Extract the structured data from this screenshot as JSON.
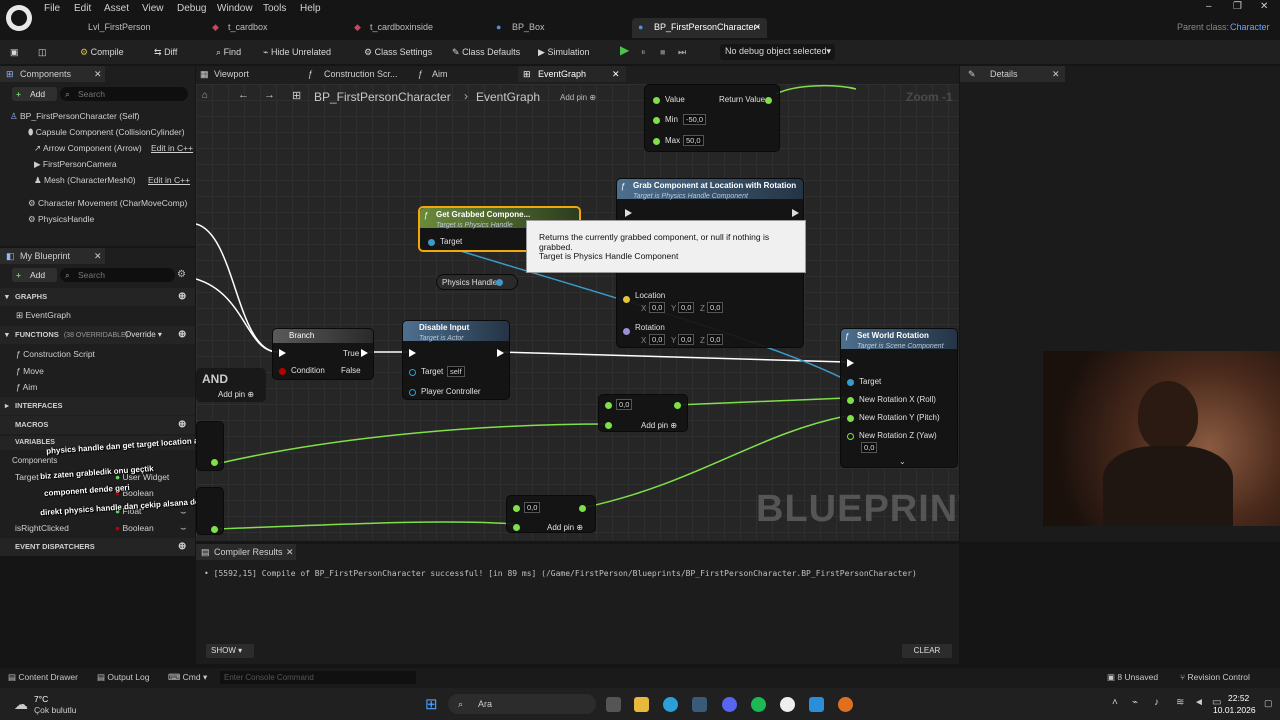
{
  "menu": [
    "File",
    "Edit",
    "Asset",
    "View",
    "Debug",
    "Window",
    "Tools",
    "Help"
  ],
  "tabs": [
    "Lvl_FirstPerson",
    "t_cardbox",
    "t_cardboxinside",
    "BP_Box",
    "BP_FirstPersonCharacter•"
  ],
  "parent_class_label": "Parent class:",
  "parent_class_value": "Character",
  "toolbar": {
    "compile": "Compile",
    "diff": "Diff",
    "find": "Find",
    "hide_unrelated": "Hide Unrelated",
    "class_settings": "Class Settings",
    "class_defaults": "Class Defaults",
    "simulation": "Simulation",
    "debug_select": "No debug object selected"
  },
  "components_panel": {
    "tab": "Components",
    "add": "Add",
    "search_placeholder": "Search",
    "items": [
      "BP_FirstPersonCharacter (Self)",
      "Capsule Component (CollisionCylinder)",
      "Arrow Component (Arrow)",
      "FirstPersonCamera",
      "Mesh (CharacterMesh0)",
      "Character Movement (CharMoveComp)",
      "PhysicsHandle"
    ],
    "edit_cpp": "Edit in C++"
  },
  "my_blueprint": {
    "tab": "My Blueprint",
    "add": "Add",
    "search_placeholder": "Search",
    "graphs": "GRAPHS",
    "event_graph": "EventGraph",
    "functions": "FUNCTIONS",
    "functions_count": "(38 OVERRIDABLE)",
    "override": "Override",
    "function_items": [
      "Construction Script",
      "Move",
      "Aim"
    ],
    "interfaces": "INTERFACES",
    "macros": "MACROS",
    "variables": "VARIABLES",
    "var_components": "Components",
    "var_rows": [
      {
        "name": "Target",
        "type": "User Widget"
      },
      {
        "name": "",
        "type": "Boolean"
      },
      {
        "name": "",
        "type": "Float"
      },
      {
        "name": "isRightClicked",
        "type": "Boolean"
      }
    ],
    "event_dispatchers": "EVENT DISPATCHERS"
  },
  "graph_tabs": [
    "Viewport",
    "Construction Scr...",
    "Aim",
    "EventGraph"
  ],
  "breadcrumb": {
    "root": "BP_FirstPersonCharacter",
    "leaf": "EventGraph"
  },
  "zoom": "Zoom -1",
  "watermark": "BLUEPRINT",
  "nodes": {
    "clamp": {
      "value": "Value",
      "return": "Return Value",
      "min_label": "Min",
      "min": "-50,0",
      "max_label": "Max",
      "max": "50,0"
    },
    "get_grabbed": {
      "title": "Get Grabbed Compone...",
      "sub": "Target is Physics Handle",
      "target": "Target"
    },
    "physics_handle": "Physics Handle",
    "grab": {
      "title": "Grab Component at Location with Rotation",
      "sub": "Target is Physics Handle Component",
      "location": "Location",
      "rotation": "Rotation",
      "zero": "0,0",
      "x": "X",
      "y": "Y",
      "z": "Z"
    },
    "branch": {
      "title": "Branch",
      "condition": "Condition",
      "true": "True",
      "false": "False"
    },
    "disable_input": {
      "title": "Disable Input",
      "sub": "Target is Actor",
      "target": "Target",
      "self": "self",
      "controller": "Player Controller"
    },
    "set_world_rotation": {
      "title": "Set World Rotation",
      "sub": "Target is Scene Component",
      "target": "Target",
      "roll": "New Rotation X (Roll)",
      "pitch": "New Rotation Y (Pitch)",
      "yaw": "New Rotation Z (Yaw)",
      "yaw_val": "0,0"
    },
    "and": {
      "title": "AND",
      "add_pin": "Add pin"
    },
    "add1": {
      "val": "0,0",
      "add_pin": "Add pin"
    },
    "add2": {
      "val": "0,0",
      "add_pin": "Add pin"
    },
    "top_add_pin": "Add pin"
  },
  "tooltip": {
    "line1": "Returns the currently grabbed component, or null if nothing is grabbed.",
    "line2": "Target is Physics Handle Component"
  },
  "overlay_notes": [
    "physics handle dan get target location and rotation",
    "biz zaten grabledik onu geçtik",
    "component dende geri",
    "direkt physics handle dan çekip alsana değil mi"
  ],
  "details": {
    "tab": "Details"
  },
  "compiler": {
    "tab": "Compiler Results",
    "message": "[5592,15] Compile of BP_FirstPersonCharacter successful! [in 89 ms] (/Game/FirstPerson/Blueprints/BP_FirstPersonCharacter.BP_FirstPersonCharacter)",
    "show": "SHOW",
    "clear": "CLEAR"
  },
  "statusbar": {
    "content_drawer": "Content Drawer",
    "output_log": "Output Log",
    "cmd": "Cmd",
    "console_placeholder": "Enter Console Command",
    "unsaved": "8 Unsaved",
    "revision": "Revision Control"
  },
  "taskbar": {
    "weather_temp": "7°C",
    "weather_desc": "Çok bulutlu",
    "search": "Ara",
    "time": "22:52",
    "date": "10.01.2026"
  }
}
